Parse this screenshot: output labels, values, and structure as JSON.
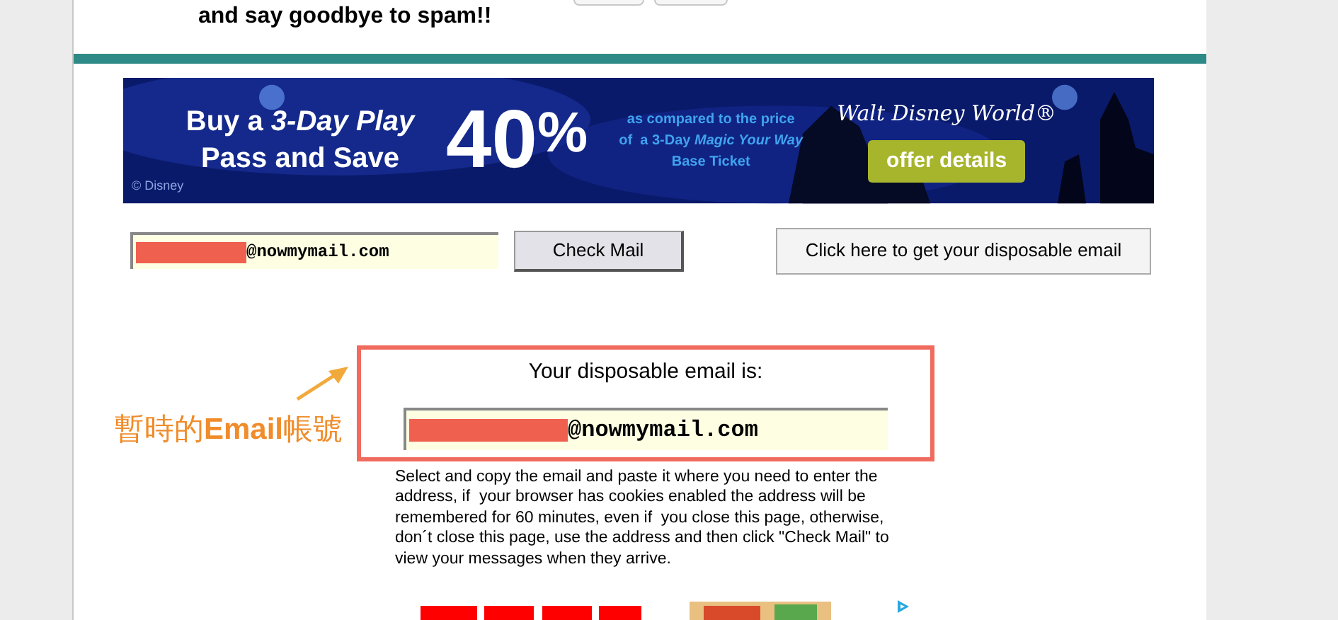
{
  "header": {
    "tagline": "and say goodbye to spam!!"
  },
  "banner": {
    "headline": [
      "Buy a *3-Day Play*",
      "Pass and Save"
    ],
    "discount": "40",
    "percent": "%",
    "note": [
      "as compared to the price",
      "of  a 3-Day *Magic Your Way*",
      "Base Ticket"
    ],
    "brand": "Walt Disney World®",
    "cta": "offer details",
    "copyright": "© Disney"
  },
  "mail_check": {
    "address": "@nowmymail.com",
    "redacted": true,
    "button": "Check Mail"
  },
  "generate_button": "Click here to get your disposable email",
  "result": {
    "title": "Your disposable email is:",
    "address": "@nowmymail.com",
    "redacted": true,
    "highlighted": true
  },
  "instructions": "Select and copy the email and paste it where you need to enter the address, if  your browser has cookies enabled the address will be remembered for 60 minutes, even if  you close this page, otherwise, don´t close this page, use the address and then click \"Check Mail\" to view your messages when they arrive.",
  "annotation": "暫時的**Email**帳號"
}
